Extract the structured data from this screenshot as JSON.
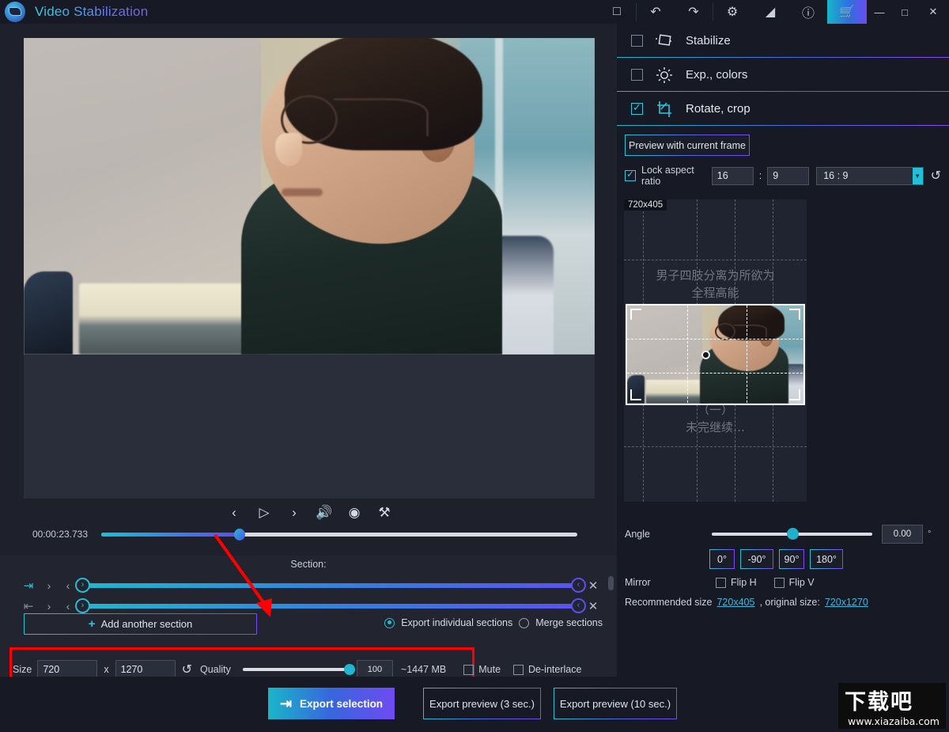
{
  "titlebar": {
    "app_title": "Video Stabilization",
    "logo_icon": "video-stabilization-logo",
    "buttons": [
      {
        "name": "fullscreen-toggle",
        "glyph": "□"
      },
      {
        "name": "undo-button",
        "glyph": "↶"
      },
      {
        "name": "redo-button",
        "glyph": "↷"
      },
      {
        "name": "settings-gear",
        "glyph": "⚙"
      },
      {
        "name": "contrast-icon",
        "glyph": "◢"
      },
      {
        "name": "info-icon",
        "glyph": "ⓘ"
      }
    ],
    "cart_glyph": "🛒",
    "minimize": "—",
    "maximize": "□",
    "close": "✕"
  },
  "player": {
    "timecode": "00:00:23.733",
    "prev_glyph": "‹",
    "play_glyph": "▷",
    "next_glyph": "›",
    "volume_glyph": "🔊",
    "eye_glyph": "◉",
    "wrench_glyph": "⚒",
    "progress_percent": 29
  },
  "sections": {
    "label": "Section:",
    "rows": [
      {
        "start_icon": "⇥",
        "end_icon": "⇤",
        "chevron_right": "›",
        "chevron_left": "‹",
        "handle_left": "›",
        "handle_right": "‹",
        "close": "✕"
      },
      {
        "start_icon": "⇥",
        "end_icon": "⇤",
        "chevron_right": "›",
        "chevron_left": "‹",
        "handle_left": "›",
        "handle_right": "‹",
        "close": "✕"
      }
    ],
    "add_button": "Add another section",
    "add_plus": "+",
    "export_individual": "Export individual sections",
    "merge_sections": "Merge sections"
  },
  "export_settings": {
    "size_label": "Size",
    "width": "720",
    "x_label": "x",
    "height": "1270",
    "reset_glyph": "↺",
    "quality_label": "Quality",
    "quality_value": "100",
    "quality_percent": 100,
    "estimated_size": "~1447 MB",
    "mute_label": "Mute",
    "deinterlace_label": "De-interlace"
  },
  "footer": {
    "export_selection": "Export selection",
    "export_icon": "⇥",
    "export_preview_3": "Export preview (3 sec.)",
    "export_preview_10": "Export preview (10 sec.)",
    "watermark_cn": "下载吧",
    "watermark_url": "www.xiazaiba.com"
  },
  "right_panel": {
    "headers": [
      {
        "label": "Stabilize",
        "icon": "stabilize-icon",
        "checked": false
      },
      {
        "label": "Exp., colors",
        "icon": "sun-icon",
        "checked": false
      },
      {
        "label": "Rotate, crop",
        "icon": "crop-icon",
        "checked": true
      }
    ],
    "preview_button": "Preview with current frame",
    "lock_aspect_label": "Lock aspect ratio",
    "aspect_w": "16",
    "aspect_colon": ":",
    "aspect_h": "9",
    "aspect_preset": "16 : 9",
    "aspect_dropdown_glyph": "▼",
    "aspect_reset_glyph": "↺",
    "crop": {
      "dimensions": "720x405",
      "overlay_top_line1": "男子四肢分离为所欲为",
      "overlay_top_line2": "全程高能",
      "overlay_bottom_line1": "（一）",
      "overlay_bottom_line2": "未完继续…"
    },
    "angle_label": "Angle",
    "angle_value": "0.00",
    "angle_unit": "°",
    "angle_percent": 50,
    "rotate_buttons": [
      "0°",
      "-90°",
      "90°",
      "180°"
    ],
    "mirror_label": "Mirror",
    "flip_h": "Flip H",
    "flip_v": "Flip V",
    "recommended_label": "Recommended size",
    "recommended_size": "720x405",
    "original_label": ", original size:",
    "original_size": "720x1270"
  },
  "colors": {
    "accent_cyan": "#2ec7dd",
    "accent_purple": "#7b4df2",
    "highlight_red": "#ff0000",
    "panel_bg": "#171a24"
  }
}
